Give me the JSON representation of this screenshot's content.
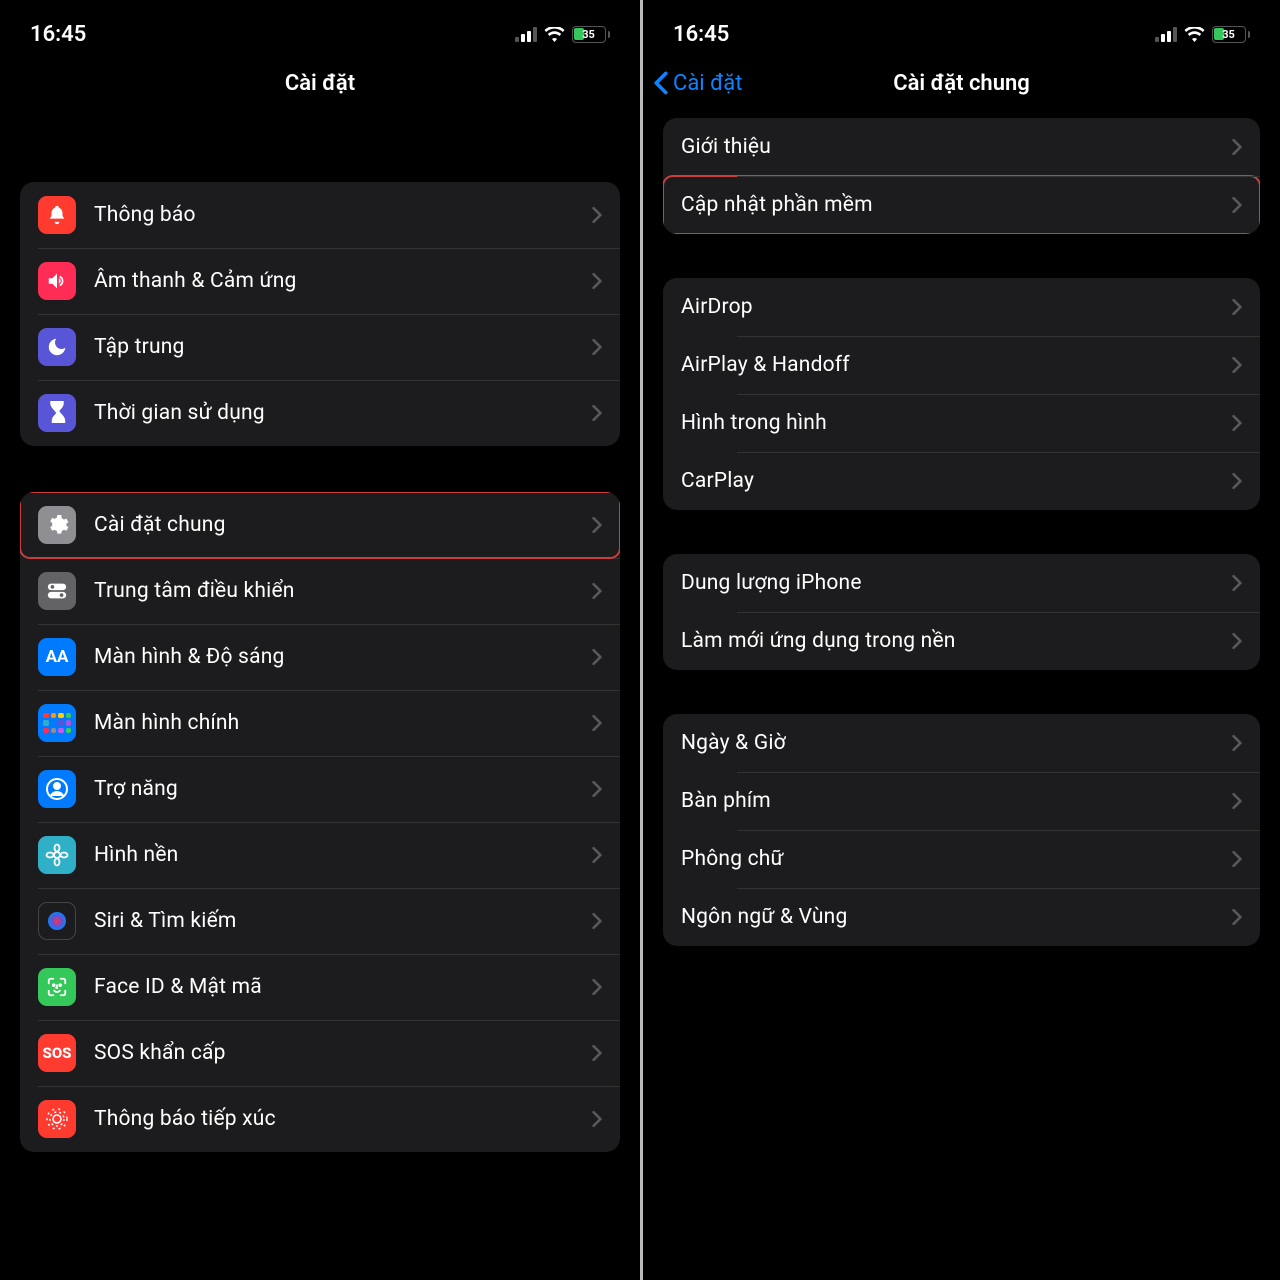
{
  "status": {
    "time": "16:45",
    "battery_pct": "35",
    "battery_fill_pct": 35
  },
  "left": {
    "title": "Cài đặt",
    "group1": [
      {
        "slug": "notifications",
        "icon": "bell",
        "bg": "ic-red",
        "label": "Thông báo"
      },
      {
        "slug": "sounds",
        "icon": "speaker",
        "bg": "ic-pink",
        "label": "Âm thanh & Cảm ứng"
      },
      {
        "slug": "focus",
        "icon": "moon",
        "bg": "ic-indigo",
        "label": "Tập trung"
      },
      {
        "slug": "screen-time",
        "icon": "hourglass",
        "bg": "ic-indigo",
        "label": "Thời gian sử dụng"
      }
    ],
    "group2": [
      {
        "slug": "general",
        "icon": "gear",
        "bg": "ic-gray",
        "label": "Cài đặt chung",
        "hl": true
      },
      {
        "slug": "control-center",
        "icon": "switches",
        "bg": "ic-darkgray",
        "label": "Trung tâm điều khiển"
      },
      {
        "slug": "display",
        "icon": "aa",
        "bg": "ic-blue",
        "label": "Màn hình & Độ sáng"
      },
      {
        "slug": "home-screen",
        "icon": "home",
        "bg": "ic-blue",
        "label": "Màn hình chính"
      },
      {
        "slug": "accessibility",
        "icon": "person",
        "bg": "ic-blue",
        "label": "Trợ năng"
      },
      {
        "slug": "wallpaper",
        "icon": "flower",
        "bg": "ic-teal",
        "label": "Hình nền"
      },
      {
        "slug": "siri",
        "icon": "siri",
        "bg": "ic-black",
        "label": "Siri & Tìm kiếm"
      },
      {
        "slug": "faceid",
        "icon": "face",
        "bg": "ic-green",
        "label": "Face ID & Mật mã"
      },
      {
        "slug": "sos",
        "icon": "sos",
        "bg": "ic-red",
        "label": "SOS khẩn cấp"
      },
      {
        "slug": "exposure",
        "icon": "exposure",
        "bg": "ic-red",
        "label": "Thông báo tiếp xúc"
      }
    ]
  },
  "right": {
    "back": "Cài đặt",
    "title": "Cài đặt chung",
    "group1": [
      {
        "slug": "about",
        "label": "Giới thiệu"
      },
      {
        "slug": "software-update",
        "label": "Cập nhật phần mềm",
        "hl": true
      }
    ],
    "group2": [
      {
        "slug": "airdrop",
        "label": "AirDrop"
      },
      {
        "slug": "airplay",
        "label": "AirPlay & Handoff"
      },
      {
        "slug": "pip",
        "label": "Hình trong hình"
      },
      {
        "slug": "carplay",
        "label": "CarPlay"
      }
    ],
    "group3": [
      {
        "slug": "storage",
        "label": "Dung lượng iPhone"
      },
      {
        "slug": "bg-refresh",
        "label": "Làm mới ứng dụng trong nền"
      }
    ],
    "group4": [
      {
        "slug": "date-time",
        "label": "Ngày & Giờ"
      },
      {
        "slug": "keyboard",
        "label": "Bàn phím"
      },
      {
        "slug": "fonts",
        "label": "Phông chữ"
      },
      {
        "slug": "language",
        "label": "Ngôn ngữ & Vùng"
      }
    ]
  }
}
